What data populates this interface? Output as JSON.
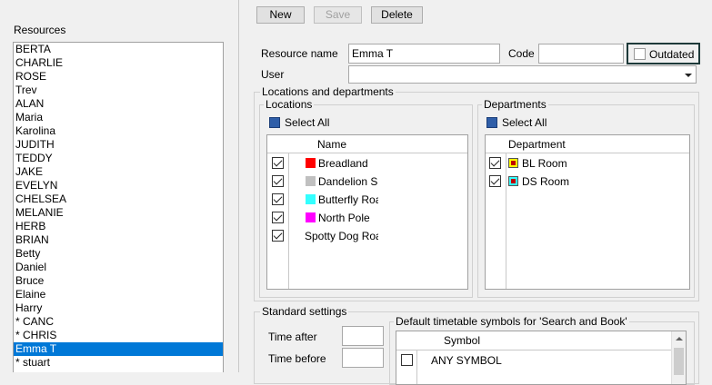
{
  "resources": {
    "label": "Resources",
    "items": [
      "BERTA",
      "CHARLIE",
      "ROSE",
      "Trev",
      "ALAN",
      "Maria",
      "Karolina",
      "JUDITH",
      "TEDDY",
      "JAKE",
      "EVELYN",
      "CHELSEA",
      "MELANIE",
      "HERB",
      "BRIAN",
      "Betty",
      "Daniel",
      "Bruce",
      "Elaine",
      "Harry",
      "* CANC",
      "* CHRIS",
      "Emma T",
      "* stuart"
    ],
    "selected_index": 22
  },
  "toolbar": {
    "new_label": "New",
    "save_label": "Save",
    "delete_label": "Delete"
  },
  "form": {
    "resource_name_label": "Resource name",
    "resource_name_value": "Emma T",
    "code_label": "Code",
    "code_value": "",
    "outdated_label": "Outdated",
    "user_label": "User",
    "user_value": ""
  },
  "locdept": {
    "title": "Locations and departments",
    "locations": {
      "title": "Locations",
      "select_all": "Select All",
      "col_name": "Name",
      "rows": [
        {
          "name": "Breadland",
          "color": "#ff0000",
          "checked": true
        },
        {
          "name": "Dandelion S",
          "color": "#c0c0c0",
          "checked": true
        },
        {
          "name": "Butterfly Roa",
          "color": "#33ffff",
          "checked": true
        },
        {
          "name": "North Pole",
          "color": "#ff00ff",
          "checked": true
        },
        {
          "name": "Spotty Dog Roa",
          "color": "",
          "checked": true
        }
      ]
    },
    "departments": {
      "title": "Departments",
      "select_all": "Select All",
      "col_name": "Department",
      "rows": [
        {
          "name": "BL Room",
          "color": "#ffff00",
          "checked": true
        },
        {
          "name": "DS Room",
          "color": "#33ffff",
          "checked": true
        }
      ]
    }
  },
  "standard": {
    "title": "Standard settings",
    "time_after_label": "Time after",
    "time_after_value": "",
    "time_before_label": "Time before",
    "time_before_value": "",
    "symbols": {
      "title": "Default timetable symbols for 'Search and Book'",
      "col_symbol": "Symbol",
      "rows": [
        {
          "name": "ANY SYMBOL",
          "checked": false
        }
      ]
    }
  }
}
